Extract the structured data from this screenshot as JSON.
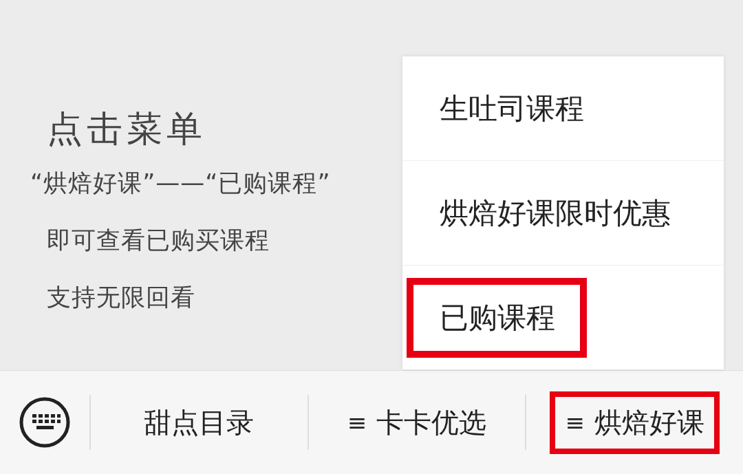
{
  "article": {
    "title": "点击菜单",
    "lines": [
      "“烘焙好课”——“已购课程”",
      "即可查看已购买课程",
      "支持无限回看"
    ]
  },
  "popup_menu": {
    "items": [
      {
        "label": "生吐司课程",
        "highlighted": false
      },
      {
        "label": "烘焙好课限时优惠",
        "highlighted": false
      },
      {
        "label": "已购课程",
        "highlighted": true
      }
    ]
  },
  "bottom_menu": {
    "items": [
      {
        "label": "甜点目录",
        "highlighted": false
      },
      {
        "icon": "≡",
        "label": "卡卡优选",
        "highlighted": false
      },
      {
        "icon": "≡",
        "label": "烘焙好课",
        "highlighted": true
      }
    ]
  }
}
